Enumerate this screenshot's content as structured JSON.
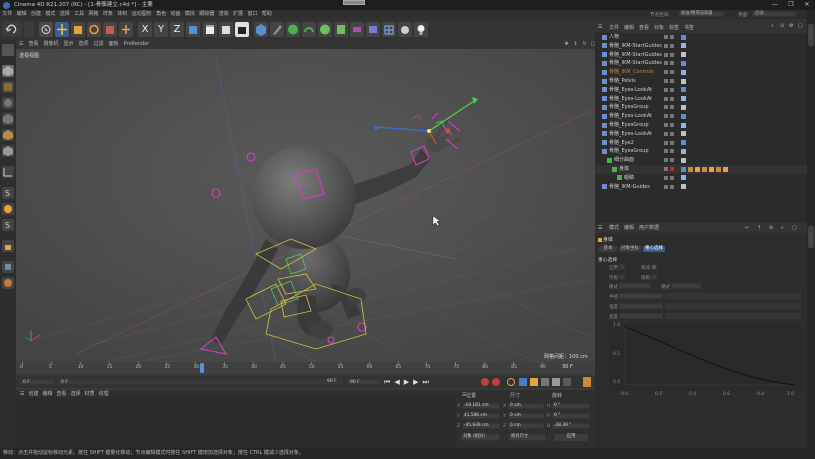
{
  "window": {
    "title": "Cinema 4D R21.207 (RC) - [1-骨骼建立.c4d *] - 主要",
    "controls": [
      "—",
      "❐",
      "✕"
    ]
  },
  "menubar": {
    "items": [
      "文件",
      "编辑",
      "创建",
      "模式",
      "选择",
      "工具",
      "网格",
      "样条",
      "体积",
      "运动图形",
      "角色",
      "动画",
      "模拟",
      "跟踪器",
      "渲染",
      "扩展",
      "窗口",
      "帮助"
    ]
  },
  "toolbar": {
    "axis_x": "X",
    "axis_y": "Y",
    "axis_z": "Z"
  },
  "viewport": {
    "menu": [
      "查看",
      "摄像机",
      "显示",
      "选项",
      "过滤",
      "面板",
      "ProRender"
    ],
    "camera_label": "透视视图",
    "grid_spacing": "网格间距：100 cm"
  },
  "timeline": {
    "ticks": [
      "0",
      "5",
      "10",
      "15",
      "20",
      "25",
      "30",
      "35",
      "40",
      "45",
      "50",
      "55",
      "60",
      "65",
      "70",
      "75",
      "80",
      "85",
      "90"
    ],
    "current_frame": "30",
    "end_label": "30 F"
  },
  "playback": {
    "start": "0 F",
    "current": "0 F",
    "end": "90 F",
    "end2": "90 F"
  },
  "bottom_menu": [
    "创建",
    "编辑",
    "查看",
    "选择",
    "材质",
    "纹理"
  ],
  "coords": {
    "headers": [
      "位置",
      "尺寸",
      "旋转"
    ],
    "rows": [
      {
        "axis": "X",
        "pos": "-19.181 cm",
        "size_axis": "X",
        "size": "0 cm",
        "rot_axis": "H",
        "rot": "0 °"
      },
      {
        "axis": "Y",
        "pos": "41.506 cm",
        "size_axis": "Y",
        "size": "0 cm",
        "rot_axis": "P",
        "rot": "0 °"
      },
      {
        "axis": "Z",
        "pos": "-45.939 cm",
        "size_axis": "Z",
        "size": "0 cm",
        "rot_axis": "B",
        "rot": "-28.39 °"
      }
    ],
    "mode_select": "对象 (相对)",
    "size_select": "绝对尺寸",
    "apply": "应用"
  },
  "right_panel": {
    "layout_label": "节点空间:",
    "layout_value": "标准/物理渲染器",
    "interface_label": "界面:",
    "interface_value": "启动",
    "tabs": [
      "文件",
      "编辑",
      "查看",
      "对象",
      "标签",
      "书签"
    ]
  },
  "objects": [
    {
      "name": "人物",
      "indent": 0,
      "color": "#cfcfcf"
    },
    {
      "name": "骨骼_IKM-StartGuides",
      "indent": 0,
      "color": "#cfcfcf"
    },
    {
      "name": "骨骼_IKM-StartGuides",
      "indent": 0,
      "color": "#cfcfcf"
    },
    {
      "name": "骨骼_IKM-StartGuides",
      "indent": 0,
      "color": "#cfcfcf"
    },
    {
      "name": "骨骼_IKM_Controls",
      "indent": 0,
      "color": "#c8823a"
    },
    {
      "name": "骨骼_Pelvis",
      "indent": 0,
      "color": "#cfcfcf"
    },
    {
      "name": "骨骼_Eyes-LookAt",
      "indent": 0,
      "color": "#cfcfcf"
    },
    {
      "name": "骨骼_Eyes-LookAt",
      "indent": 0,
      "color": "#cfcfcf"
    },
    {
      "name": "骨骼_EyesGroup",
      "indent": 0,
      "color": "#cfcfcf"
    },
    {
      "name": "骨骼_Eyes-LookAt",
      "indent": 0,
      "color": "#cfcfcf"
    },
    {
      "name": "骨骼_EyesGroup",
      "indent": 0,
      "color": "#cfcfcf"
    },
    {
      "name": "骨骼_Eyes-LookAt",
      "indent": 0,
      "color": "#cfcfcf"
    },
    {
      "name": "骨骼_Eye2",
      "indent": 0,
      "color": "#cfcfcf"
    },
    {
      "name": "骨骼_EyesGroup",
      "indent": 0,
      "color": "#cfcfcf"
    },
    {
      "name": "细分曲面",
      "indent": 1,
      "color": "#cfcfcf"
    },
    {
      "name": "身体",
      "indent": 2,
      "color": "#cfcfcf"
    },
    {
      "name": "眼睛",
      "indent": 3,
      "color": "#cfcfcf"
    },
    {
      "name": "骨骼_IKM-Guides",
      "indent": 0,
      "color": "#cfcfcf"
    }
  ],
  "attributes": {
    "tabs": [
      "模式",
      "编辑",
      "用户数据"
    ],
    "object_name": "身体",
    "subtabs": [
      "基本",
      "对象坐标",
      "重心选择"
    ],
    "section": "重心选择",
    "fields": [
      {
        "label": "启用",
        "label2": "衰减"
      },
      {
        "label": "可视",
        "label2": "限制"
      },
      {
        "label": "模式",
        "label2": "模式"
      },
      {
        "label": "半径"
      },
      {
        "label": "强度"
      },
      {
        "label": "宽度"
      }
    ],
    "graph_y": [
      "1.0",
      "0.5",
      "0.0"
    ],
    "graph_x": [
      "0.0",
      "0.2",
      "0.4",
      "0.6",
      "0.8",
      "1.0"
    ]
  },
  "statusbar": {
    "text": "移动：点击并拖动鼠标移动元素。按住 SHIFT 键量化移动；节点编辑模式时按住 SHIFT 键增加选择对象；按住 CTRL 键减少选择对象。"
  }
}
